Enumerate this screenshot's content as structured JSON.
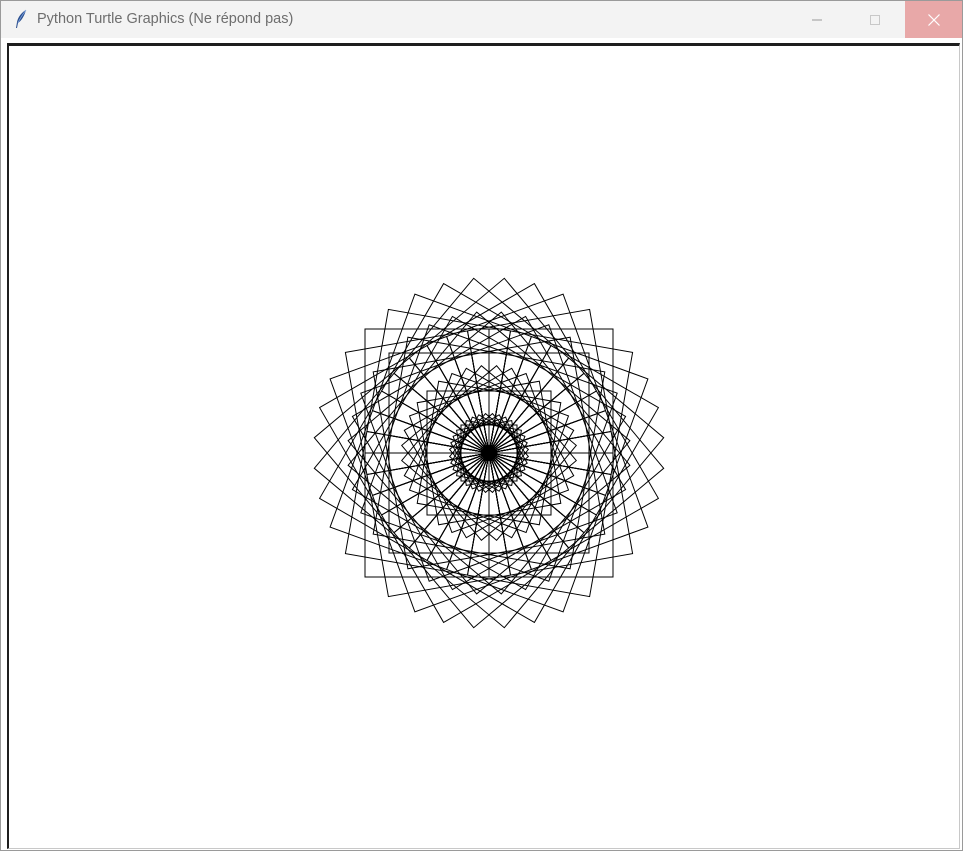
{
  "window": {
    "title": "Python Turtle Graphics (Ne répond pas)",
    "app_icon": "feather-icon",
    "controls": {
      "minimize_icon": "minimize-icon",
      "maximize_icon": "maximize-icon",
      "close_icon": "close-icon"
    }
  },
  "colors": {
    "titlebar_bg": "#f3f3f3",
    "title_text": "#6e6e6e",
    "close_bg": "#e8a8a8",
    "canvas_bg": "#ffffff",
    "stroke": "#000000"
  },
  "drawing": {
    "shape": "square",
    "rotation_step_deg": 10,
    "sizes": [
      124,
      100,
      62,
      28
    ]
  }
}
